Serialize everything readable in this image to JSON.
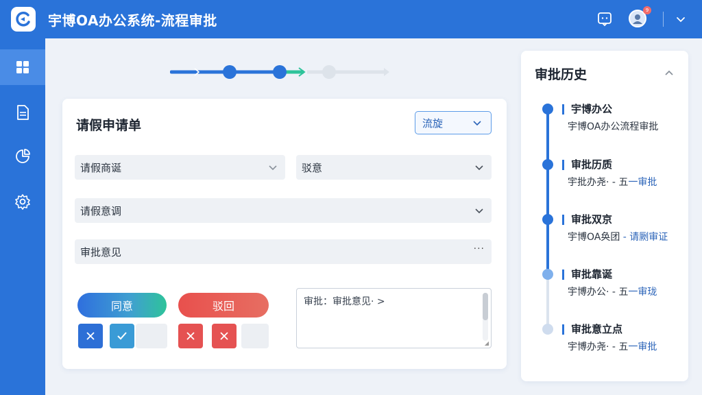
{
  "app": {
    "title": "宇博OA办公系统-流程审批"
  },
  "header": {
    "icons": [
      "chat-icon",
      "avatar",
      "chevron-down-icon"
    ],
    "notification_count": "9"
  },
  "sidebar": {
    "items": [
      {
        "icon": "dashboard-icon",
        "active": true
      },
      {
        "icon": "document-icon",
        "active": false
      },
      {
        "icon": "report-icon",
        "active": false
      },
      {
        "icon": "gear-icon",
        "active": false
      }
    ]
  },
  "stepper": {
    "steps": 4,
    "completed": 2
  },
  "form": {
    "title": "请假申请单",
    "status": "流旋",
    "fields": {
      "leave_type": "请假商诞",
      "reason_select": "驳意",
      "leave_detail": "请假意调",
      "approval_opinion": "审批意见",
      "approval_opinion_suffix": "···"
    },
    "buttons": {
      "agree": "同意",
      "reject": "驳回"
    },
    "textarea": {
      "value": "审批：审批意见·  >"
    }
  },
  "history": {
    "title": "审批历史",
    "items": [
      {
        "title": "宇博办公",
        "sub": "宇博OA办公流程审批",
        "sub_highlight": ""
      },
      {
        "title": "审批历质",
        "sub": "宇批办尧· - 五",
        "sub_highlight": "一审批"
      },
      {
        "title": "审批双京",
        "sub": "宇博OA奂团",
        "sub_highlight": " - 请劂审证"
      },
      {
        "title": "审批靠诞",
        "sub": "宇博办公· - 五",
        "sub_highlight": "一审珑"
      },
      {
        "title": "审批意立点",
        "sub": "宇博办尧· - 五",
        "sub_highlight": "一审批"
      }
    ]
  },
  "colors": {
    "primary": "#2a73d9",
    "success": "#2ec39a",
    "danger": "#e55252",
    "background": "#eef2f8"
  }
}
